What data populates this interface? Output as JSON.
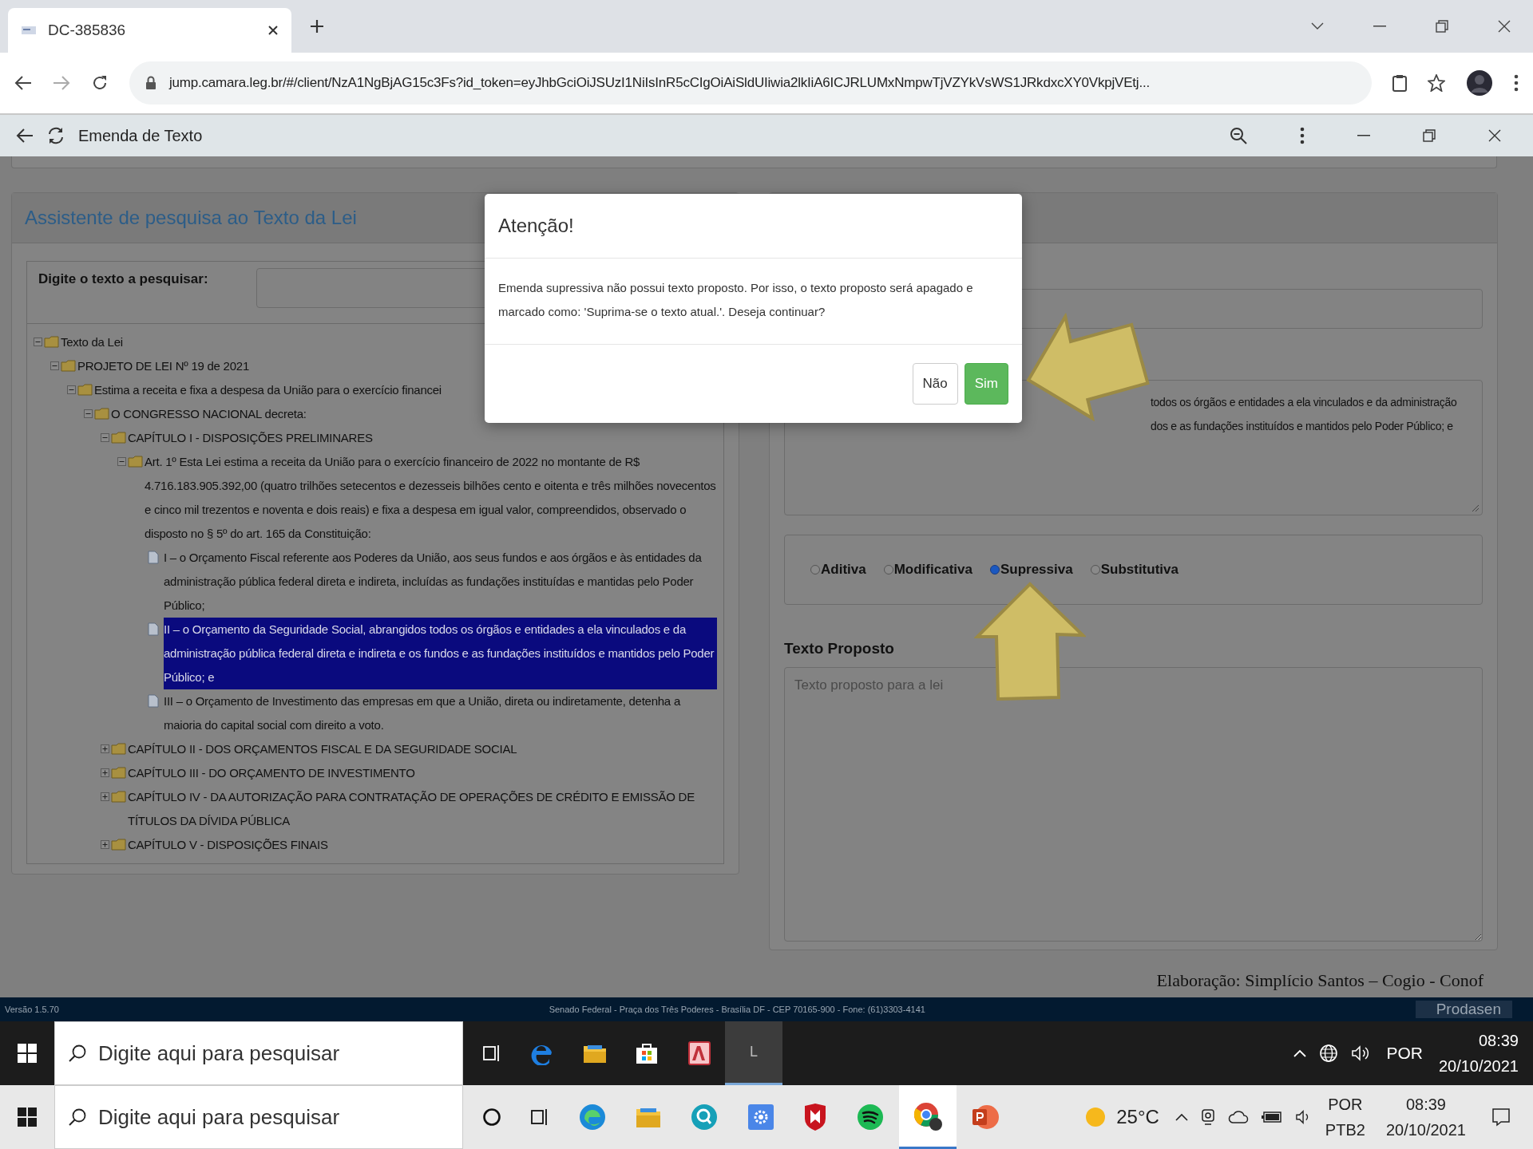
{
  "browser": {
    "tab_title": "DC-385836",
    "url": "jump.camara.leg.br/#/client/NzA1NgBjAG15c3Fs?id_token=eyJhbGciOiJSUzI1NiIsInR5cCIgOiAiSldUIiwia2lkIiA6ICJRLUMxNmpwTjVZYkVsWS1JRkdxcXY0VkpjVEtj..."
  },
  "app_bar": {
    "title": "Emenda de Texto"
  },
  "search_panel": {
    "title": "Assistente de pesquisa ao Texto da Lei",
    "search_label": "Digite o texto a pesquisar:",
    "tree": [
      {
        "kind": "folder",
        "text": "Texto da Lei",
        "expanded": true,
        "selected": false,
        "children": [
          {
            "kind": "folder",
            "text": "PROJETO DE LEI Nº 19 de 2021",
            "expanded": true,
            "selected": false,
            "children": [
              {
                "kind": "folder",
                "text": "Estima a receita e fixa a despesa da União para o exercício financei",
                "expanded": true,
                "selected": false,
                "children": [
                  {
                    "kind": "folder",
                    "text": "O CONGRESSO NACIONAL decreta:",
                    "expanded": true,
                    "selected": false,
                    "children": [
                      {
                        "kind": "folder",
                        "text": "CAPÍTULO I - DISPOSIÇÕES PRELIMINARES",
                        "expanded": true,
                        "selected": false,
                        "children": [
                          {
                            "kind": "folder",
                            "text": "Art. 1º Esta Lei estima a receita da União para o exercício financeiro de 2022 no montante de R$ 4.716.183.905.392,00 (quatro trilhões setecentos e dezesseis bilhões cento e oitenta e três milhões novecentos e cinco mil trezentos e noventa e dois reais) e fixa a despesa em igual valor, compreendidos, observado o disposto no § 5º do art. 165 da Constituição:",
                            "expanded": true,
                            "selected": false,
                            "children": [
                              {
                                "kind": "document",
                                "text": "I – o Orçamento Fiscal referente aos Poderes da União, aos seus fundos e aos órgãos e às entidades da administração pública federal direta e indireta, incluídas as fundações instituídas e mantidas pelo Poder Público;",
                                "selected": false
                              },
                              {
                                "kind": "document",
                                "text": "II – o Orçamento da Seguridade Social, abrangidos todos os órgãos e entidades a ela vinculados e da administração pública federal direta e indireta e os fundos e as fundações instituídos e mantidos pelo Poder Público; e",
                                "selected": true
                              },
                              {
                                "kind": "document",
                                "text": "III – o Orçamento de Investimento das empresas em que a União, direta ou indiretamente, detenha a maioria do capital social com direito a voto.",
                                "selected": false
                              }
                            ]
                          }
                        ]
                      },
                      {
                        "kind": "folder",
                        "text": "CAPÍTULO II - DOS ORÇAMENTOS FISCAL E DA SEGURIDADE SOCIAL",
                        "expanded": false,
                        "selected": false
                      },
                      {
                        "kind": "folder",
                        "text": "CAPÍTULO III - DO ORÇAMENTO DE INVESTIMENTO",
                        "expanded": false,
                        "selected": false
                      },
                      {
                        "kind": "folder",
                        "text": "CAPÍTULO IV - DA AUTORIZAÇÃO PARA CONTRATAÇÃO DE OPERAÇÕES DE CRÉDITO E EMISSÃO DE TÍTULOS DA DÍVIDA PÚBLICA",
                        "expanded": false,
                        "selected": false
                      },
                      {
                        "kind": "folder",
                        "text": "CAPÍTULO V - DISPOSIÇÕES FINAIS",
                        "expanded": false,
                        "selected": false
                      }
                    ]
                  }
                ]
              }
            ]
          }
        ]
      }
    ]
  },
  "right_panel": {
    "current_text": [
      "todos os órgãos e entidades a ela vinculados e da administração",
      "dos e as fundações instituídos e mantidos pelo Poder Público; e"
    ],
    "amendment_types": [
      {
        "label": "Aditiva",
        "selected": false
      },
      {
        "label": "Modificativa",
        "selected": false
      },
      {
        "label": "Supressiva",
        "selected": true
      },
      {
        "label": "Substitutiva",
        "selected": false
      }
    ],
    "proposed_label": "Texto Proposto",
    "proposed_placeholder": "Texto proposto para a lei"
  },
  "credit": "Elaboração: Simplício Santos – Cogio - Conof",
  "dialog": {
    "title": "Atenção!",
    "message": "Emenda supressiva não possui texto proposto. Por isso, o texto proposto será apagado e marcado como: 'Suprima-se o texto atual.'. Deseja continuar?",
    "buttons": [
      {
        "label": "Não",
        "kind": "default"
      },
      {
        "label": "Sim",
        "kind": "primary"
      }
    ]
  },
  "footer": {
    "version": "Versão 1.5.70",
    "address": "Senado Federal - Praça dos Três Poderes - Brasília DF - CEP 70165-900 - Fone: (61)3303-4141",
    "logo": "Prodasen"
  },
  "inner_taskbar": {
    "search_placeholder": "Digite aqui para pesquisar",
    "app_letter": "L",
    "language": "POR",
    "time": "08:39",
    "date": "20/10/2021"
  },
  "outer_taskbar": {
    "search_placeholder": "Digite aqui para pesquisar",
    "temperature": "25°C",
    "language": "POR",
    "keyboard": "PTB2",
    "time": "08:39",
    "date": "20/10/2021"
  }
}
